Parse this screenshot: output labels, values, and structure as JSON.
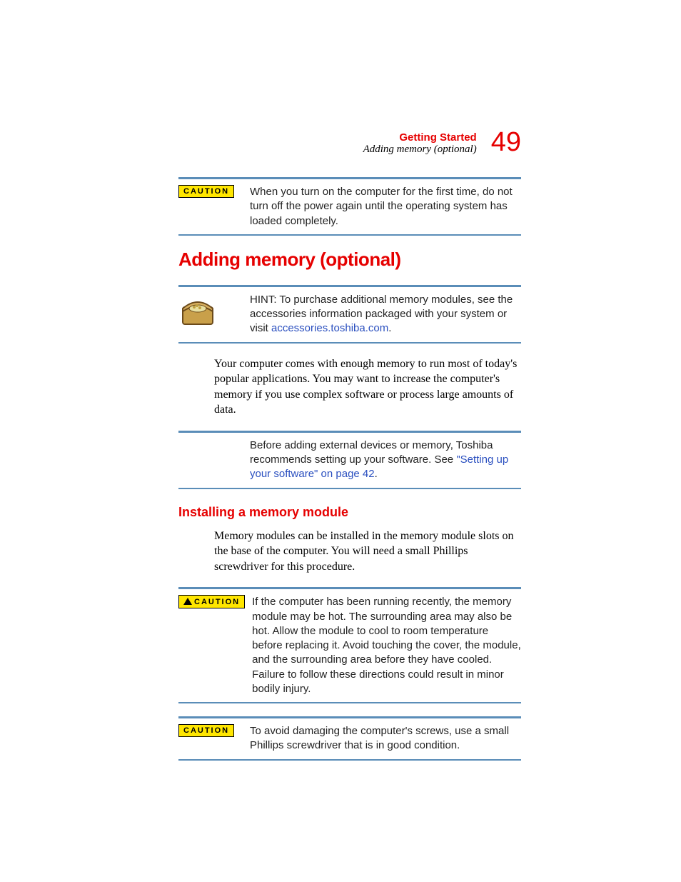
{
  "header": {
    "chapter": "Getting Started",
    "section": "Adding memory (optional)",
    "page_number": "49"
  },
  "caution1": {
    "label": "CAUTION",
    "text": "When you turn on the computer for the first time, do not turn off the power again until the operating system has loaded completely."
  },
  "h1": "Adding memory (optional)",
  "hint": {
    "text": "HINT: To purchase additional memory modules, see the accessories information packaged with your system or visit ",
    "link": "accessories.toshiba.com",
    "suffix": "."
  },
  "body1": "Your computer comes with enough memory to run most of today's popular applications. You may want to increase the computer's memory if you use complex software or process large amounts of data.",
  "note": {
    "text": "Before adding external devices or memory, Toshiba recommends setting up your software. See ",
    "link": "\"Setting up your software\" on page 42",
    "suffix": "."
  },
  "h2": "Installing a memory module",
  "body2": "Memory modules can be installed in the memory module slots on the base of the computer. You will need a small Phillips screwdriver for this procedure.",
  "caution2": {
    "label": "CAUTION",
    "text": "If the computer has been running recently, the memory module may be hot. The surrounding area may also be hot. Allow the module to cool to room temperature before replacing it. Avoid touching the cover, the module, and the surrounding area before they have cooled. Failure to follow these directions could result in minor bodily injury."
  },
  "caution3": {
    "label": "CAUTION",
    "text": "To avoid damaging the computer's screws, use a small Phillips screwdriver that is in good condition."
  }
}
